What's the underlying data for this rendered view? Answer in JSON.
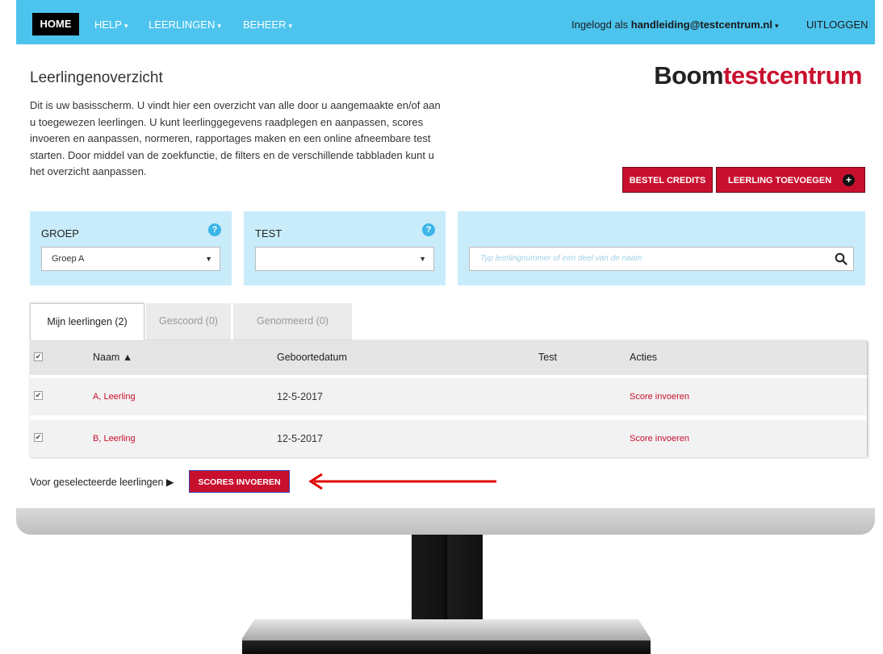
{
  "nav": {
    "home": "HOME",
    "help": "HELP",
    "leerlingen": "LEERLINGEN",
    "beheer": "BEHEER",
    "logged_in_prefix": "Ingelogd als",
    "user": "handleiding@testcentrum.nl",
    "logout": "UITLOGGEN"
  },
  "page": {
    "title": "Leerlingenoverzicht",
    "intro": "Dit is uw basisscherm. U vindt hier een overzicht van alle door u aangemaakte en/of aan u toegewezen leerlingen. U kunt leerlinggegevens raadplegen en aanpassen, scores invoeren en aanpassen, normeren, rapportages maken en een online afneembare test starten. Door middel van de zoekfunctie, de filters en de verschillende tabbladen kunt u het overzicht aanpassen."
  },
  "brand": {
    "part1": "Boom",
    "part2": "testcentrum"
  },
  "buttons": {
    "bestel_credits": "BESTEL CREDITS",
    "leerling_toevoegen": "LEERLING TOEVOEGEN",
    "plus": "+"
  },
  "filters": {
    "groep": {
      "label": "GROEP",
      "value": "Groep A",
      "help": "?"
    },
    "test": {
      "label": "TEST",
      "value": "",
      "help": "?"
    },
    "search": {
      "placeholder": "Typ leerlingnummer of een deel van de naam"
    }
  },
  "tabs": [
    {
      "label": "Mijn leerlingen (2)"
    },
    {
      "label": "Gescoord (0)"
    },
    {
      "label": "Genormeerd (0)"
    }
  ],
  "table": {
    "headers": {
      "naam": "Naam ▲",
      "geboortedatum": "Geboortedatum",
      "test": "Test",
      "acties": "Acties"
    },
    "rows": [
      {
        "naam": "A, Leerling",
        "geboortedatum": "12-5-2017",
        "test": "",
        "actie": "Score invoeren"
      },
      {
        "naam": "B, Leerling",
        "geboortedatum": "12-5-2017",
        "test": "",
        "actie": "Score invoeren"
      }
    ]
  },
  "bulk": {
    "text": "Voor geselecteerde leerlingen ▶",
    "button": "SCORES INVOEREN"
  },
  "colors": {
    "nav": "#4dc4ee",
    "accent": "#c8102e",
    "panel": "#c9ecfa"
  }
}
